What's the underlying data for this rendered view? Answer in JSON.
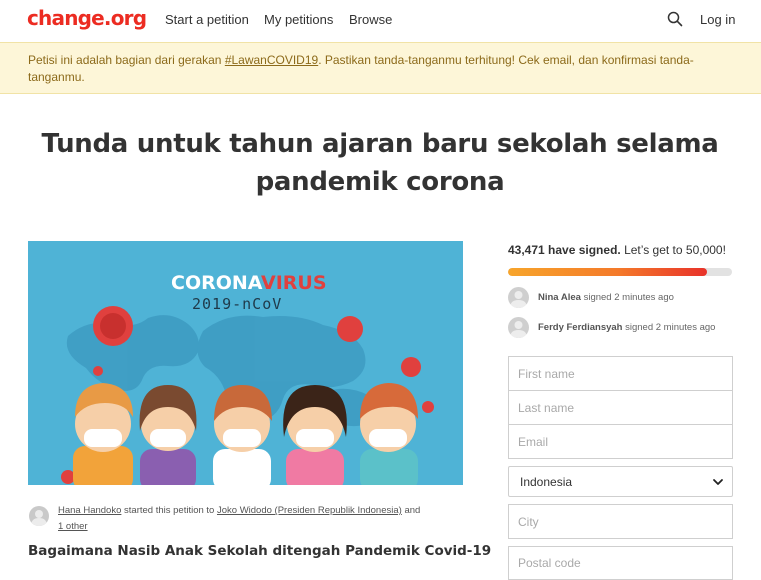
{
  "header": {
    "logo": "change.org",
    "nav": [
      "Start a petition",
      "My petitions",
      "Browse"
    ],
    "login": "Log in"
  },
  "banner": {
    "text_before": "Petisi ini adalah bagian dari gerakan ",
    "link": "#LawanCOVID19",
    "text_after": ". Pastikan tanda-tanganmu terhitung! Cek email, dan konfirmasi tanda-tanganmu."
  },
  "petition": {
    "title": "Tunda untuk tahun ajaran baru sekolah selama pandemik corona",
    "hero": {
      "headline_part1": "CORONA",
      "headline_part2": "VIRUS",
      "subheadline": "2019-nCoV"
    },
    "starter_name": "Hana Handoko",
    "starter_mid": " started this petition to ",
    "target": "Joko Widodo (Presiden Republik Indonesia)",
    "and": " and ",
    "others": "1 other",
    "subtitle": "Bagaimana Nasib Anak Sekolah ditengah Pandemik Covid-19"
  },
  "signatures": {
    "count": "43,471 have signed.",
    "goal_text": " Let’s get to 50,000!",
    "progress": 0.89,
    "recent": [
      {
        "name": "Nina Alea",
        "action": " signed 2 minutes ago"
      },
      {
        "name": "Ferdy Ferdiansyah",
        "action": " signed 2 minutes ago"
      }
    ]
  },
  "form": {
    "first_name_placeholder": "First name",
    "last_name_placeholder": "Last name",
    "email_placeholder": "Email",
    "country_value": "Indonesia",
    "city_placeholder": "City",
    "postal_placeholder": "Postal code"
  },
  "colors": {
    "brand": "#ec2c22",
    "banner_bg": "#fdf6d8",
    "banner_text": "#8c6a1a",
    "hero_bg": "#4fb3d6",
    "progress_start": "#f7a52b",
    "progress_end": "#e8322a"
  },
  "icons": {
    "search": "search-icon",
    "chevron": "chevron-down-icon",
    "avatar": "avatar"
  }
}
